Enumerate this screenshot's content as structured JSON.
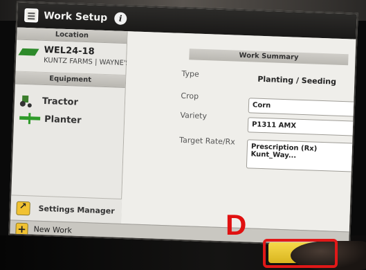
{
  "window": {
    "title": "Work Setup",
    "info_glyph": "i"
  },
  "left_panel": {
    "location_header": "Location",
    "location": {
      "name": "WEL24-18",
      "sub": "KUNTZ FARMS | WAYNE'S"
    },
    "equipment_header": "Equipment",
    "equipment": [
      {
        "label": "Tractor",
        "icon": "tractor-icon"
      },
      {
        "label": "Planter",
        "icon": "planter-icon"
      }
    ],
    "settings_manager": "Settings Manager"
  },
  "work_summary": {
    "header": "Work Summary",
    "type_label": "Type",
    "type_value": "Planting / Seeding",
    "crop_label": "Crop",
    "crop_value": "Corn",
    "variety_label": "Variety",
    "variety_value": "P1311 AMX",
    "target_rate_label": "Target Rate/Rx",
    "target_rate_value_line1": "Prescription (Rx)",
    "target_rate_value_line2": "Kunt_Way..."
  },
  "bottom_bar": {
    "new_work": "New Work",
    "plus_glyph": "+"
  },
  "annotation": {
    "letter": "D",
    "color": "#e01010"
  },
  "colors": {
    "accent_yellow": "#f1c232",
    "equipment_green": "#2f9b2a",
    "title_bar": "#1f1e1c"
  }
}
